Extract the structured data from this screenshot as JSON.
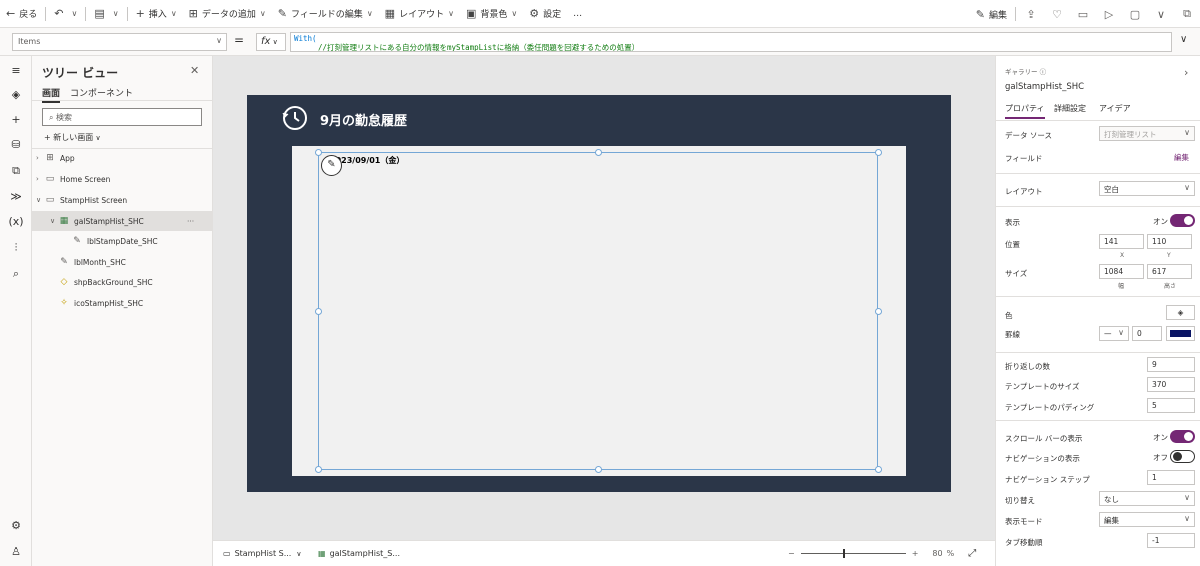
{
  "toolbar": {
    "back": "戻る",
    "insert": "挿入",
    "add_data": "データの追加",
    "edit_fields": "フィールドの編集",
    "layout": "レイアウト",
    "bg_color": "背景色",
    "settings": "設定",
    "more": "…",
    "edit": "編集"
  },
  "formula": {
    "property": "Items",
    "eq": "=",
    "fx": "fx",
    "code_line1": "With(",
    "code_line2": "//打刻管理リストにある自分の情報をmyStampListに格納（委任問題を回避するための処置）"
  },
  "tree": {
    "title": "ツリー ビュー",
    "tab_screens": "画面",
    "tab_components": "コンポーネント",
    "search_placeholder": "検索",
    "new_screen": "新しい画面",
    "nodes": [
      {
        "label": "App"
      },
      {
        "label": "Home Screen"
      },
      {
        "label": "StampHist Screen"
      },
      {
        "label": "galStampHist_SHC",
        "more": "···"
      },
      {
        "label": "lblStampDate_SHC"
      },
      {
        "label": "lblMonth_SHC"
      },
      {
        "label": "shpBackGround_SHC"
      },
      {
        "label": "icoStampHist_SHC"
      }
    ]
  },
  "canvas": {
    "title": "9月の勤怠履歴",
    "gallery_date": "2023/09/01（金）"
  },
  "status": {
    "crumb1": "StampHist S...",
    "crumb2": "galStampHist_S...",
    "zoom_minus": "−",
    "zoom_plus": "+",
    "zoom_value": "80",
    "zoom_unit": "%"
  },
  "props": {
    "type": "ギャラリー",
    "name": "galStampHist_SHC",
    "tab_props": "プロパティ",
    "tab_adv": "詳細設定",
    "tab_ideas": "アイデア",
    "datasource_label": "データ ソース",
    "datasource_value": "打刻管理リスト",
    "fields_label": "フィールド",
    "fields_edit": "編集",
    "layout_label": "レイアウト",
    "layout_value": "空白",
    "visible_label": "表示",
    "visible_state": "オン",
    "position_label": "位置",
    "pos_x": "141",
    "pos_y": "110",
    "x_sub": "X",
    "y_sub": "Y",
    "size_label": "サイズ",
    "width": "1084",
    "height": "617",
    "w_sub": "幅",
    "h_sub": "高さ",
    "color_label": "色",
    "border_label": "罫線",
    "border_width": "0",
    "border_color": "#0a1464",
    "wrap_label": "折り返しの数",
    "wrap_value": "9",
    "tsize_label": "テンプレートのサイズ",
    "tsize_value": "370",
    "tpad_label": "テンプレートのパディング",
    "tpad_value": "5",
    "scroll_label": "スクロール バーの表示",
    "scroll_state": "オン",
    "nav_label": "ナビゲーションの表示",
    "nav_state": "オフ",
    "navstep_label": "ナビゲーション ステップ",
    "navstep_value": "1",
    "trans_label": "切り替え",
    "trans_value": "なし",
    "mode_label": "表示モード",
    "mode_value": "編集",
    "tab_label": "タブ移動順",
    "tab_value": "-1"
  },
  "colors": {
    "accent": "#742774",
    "screen_bg": "#2b3648",
    "selection": "#75a7d6"
  }
}
